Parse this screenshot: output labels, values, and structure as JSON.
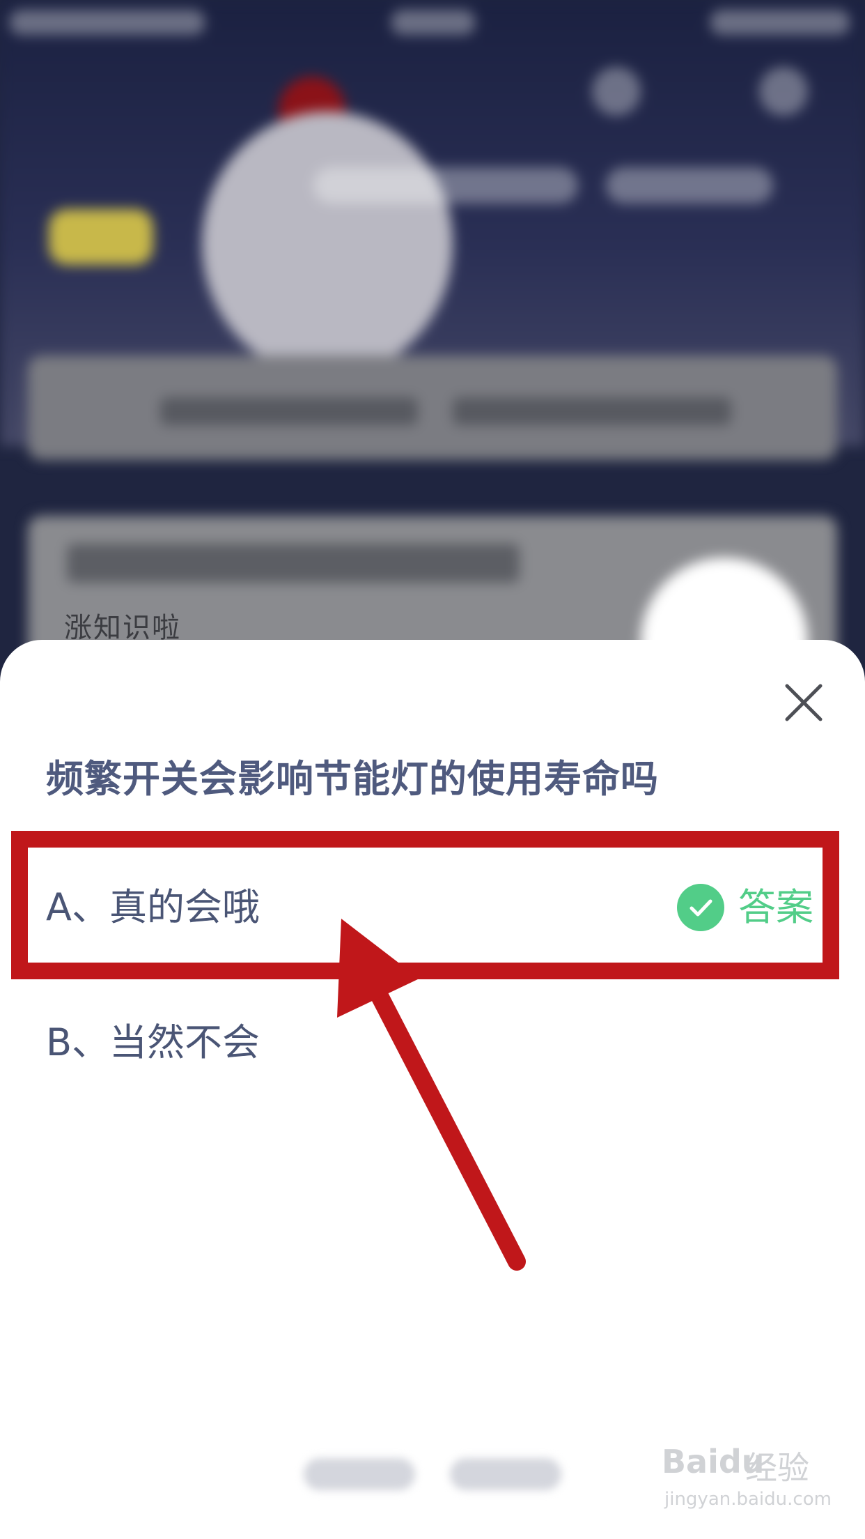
{
  "background": {
    "card_title": "涨知识啦"
  },
  "dialog": {
    "question": "频繁开关会影响节能灯的使用寿命吗",
    "options": [
      {
        "label": "A、真的会哦",
        "is_answer": true
      },
      {
        "label": "B、当然不会",
        "is_answer": false
      }
    ],
    "answer_badge": "答案",
    "close_icon": "close-icon",
    "check_icon": "check-circle-icon"
  },
  "colors": {
    "accent_green": "#52cd88",
    "annotation_red": "#c0171a",
    "question_text": "#4f5a7e"
  },
  "watermark": {
    "brand": "Baidu",
    "brand_cn": "经验",
    "url": "jingyan.baidu.com"
  }
}
